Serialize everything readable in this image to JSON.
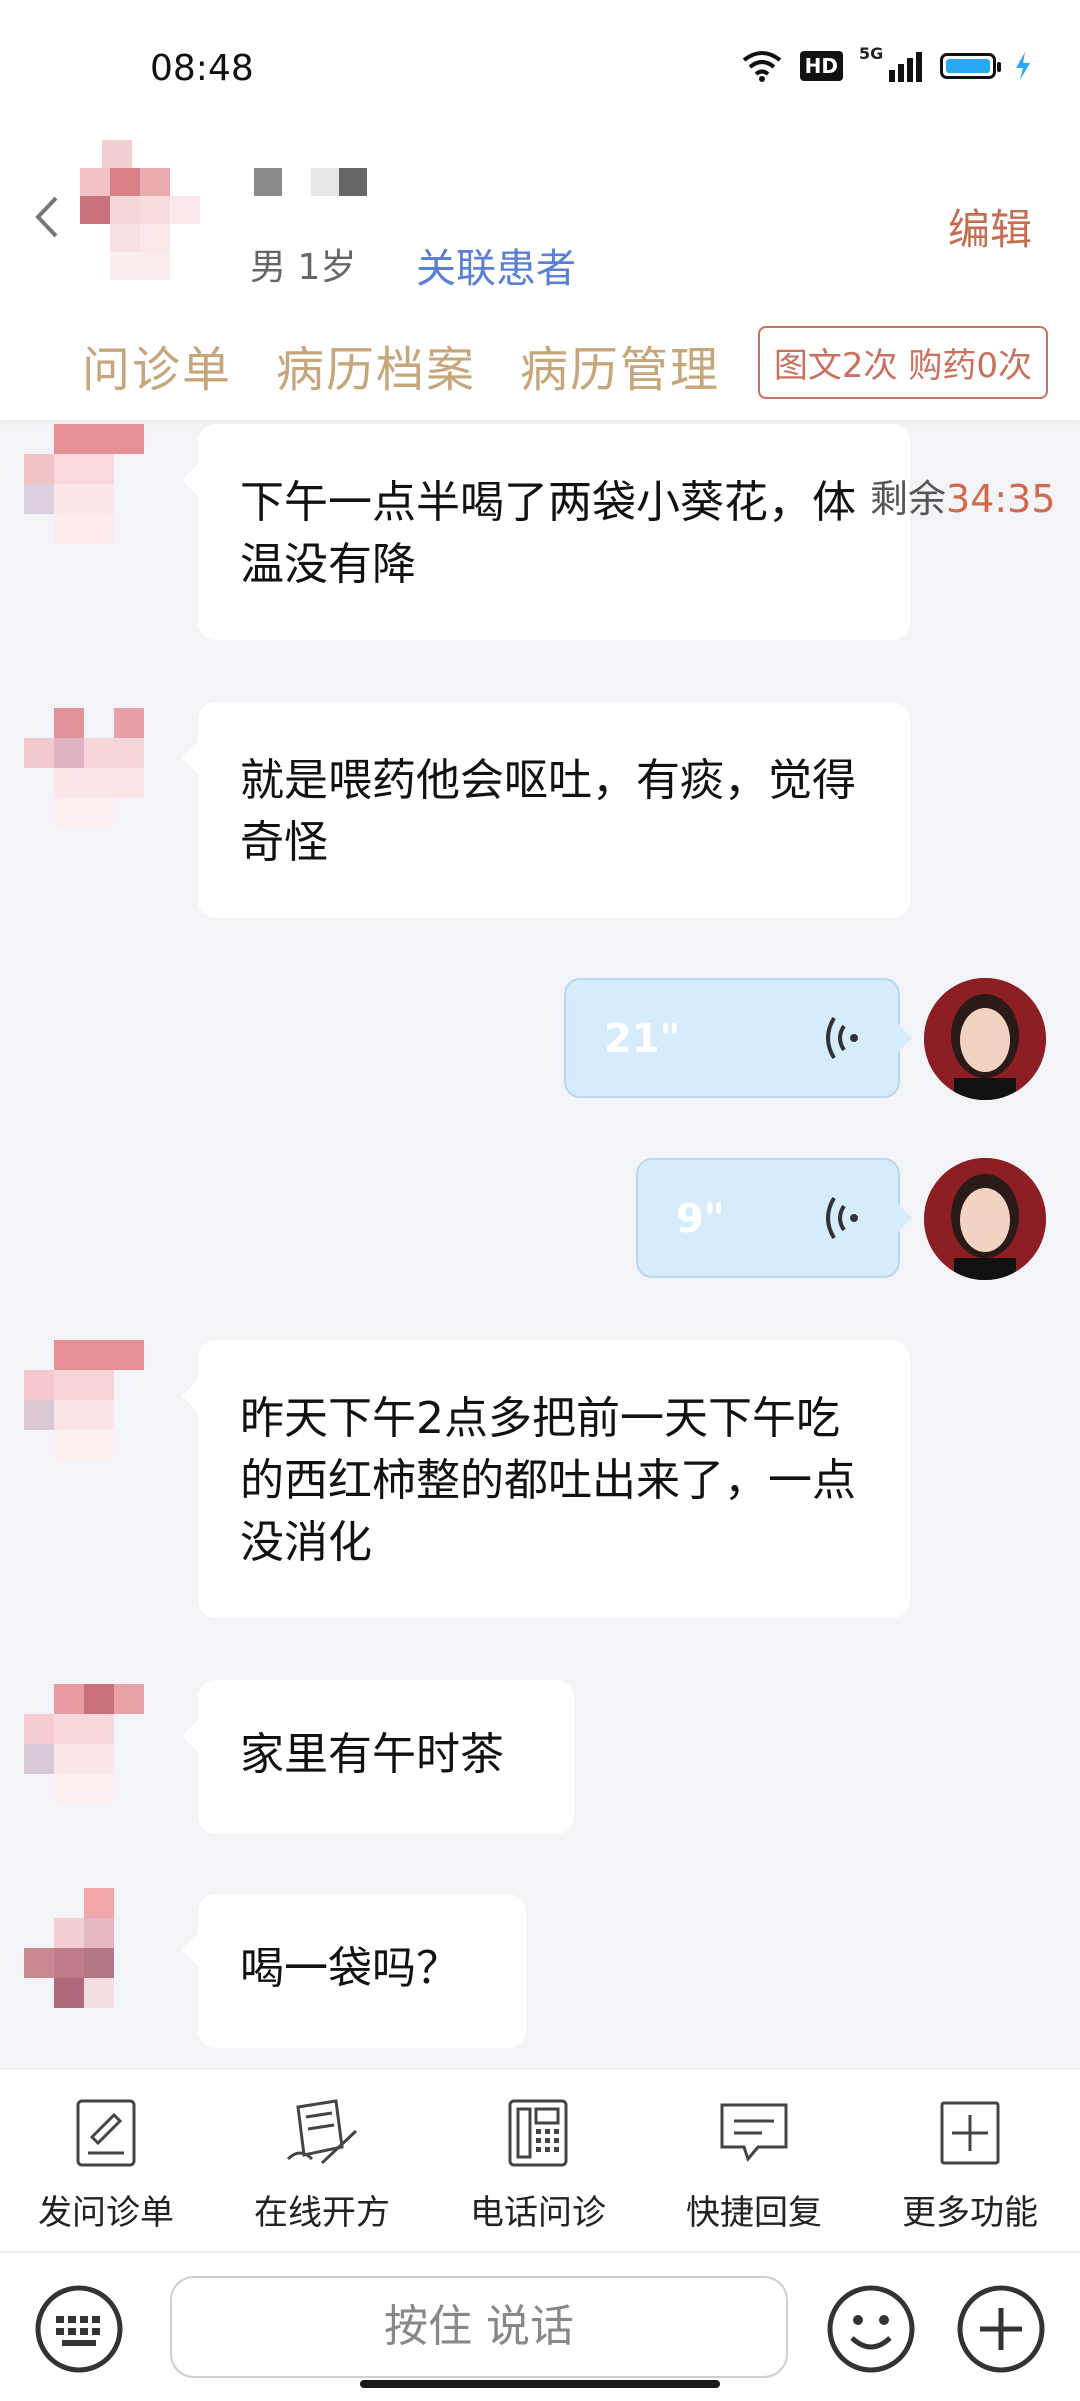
{
  "status": {
    "time": "08:48",
    "hd": "HD",
    "network": "5G"
  },
  "patient": {
    "info": "男 1岁",
    "link": "关联患者",
    "edit": "编辑"
  },
  "tabs": [
    "问诊单",
    "病历档案",
    "病历管理"
  ],
  "badge": "图文2次 购药0次",
  "timer": {
    "label": "剩余",
    "value": "34:35"
  },
  "messages": [
    {
      "text": "下午一点半喝了两袋小葵花，体温没有降"
    },
    {
      "text": "就是喂药他会呕吐，有痰，觉得奇怪"
    },
    {
      "duration": "21\""
    },
    {
      "duration": "9\""
    },
    {
      "text": "昨天下午2点多把前一天下午吃的西红柿整的都吐出来了，一点没消化"
    },
    {
      "text": "家里有午时茶"
    },
    {
      "text": "喝一袋吗？"
    }
  ],
  "toolbar": [
    "发问诊单",
    "在线开方",
    "电话问诊",
    "快捷回复",
    "更多功能"
  ],
  "input": {
    "hold_to_talk": "按住 说话"
  },
  "colors": {
    "accent": "#c46f52",
    "link": "#5a7fd8",
    "tab": "#c6a77b",
    "voice_bg": "#d6ebfb"
  },
  "icons": [
    "back-icon",
    "wifi-icon",
    "signal-icon",
    "battery-icon",
    "charging-icon",
    "voice-wave-icon",
    "form-icon",
    "prescription-icon",
    "phone-icon",
    "quick-reply-icon",
    "more-icon",
    "keyboard-icon",
    "emoji-icon",
    "plus-icon"
  ]
}
